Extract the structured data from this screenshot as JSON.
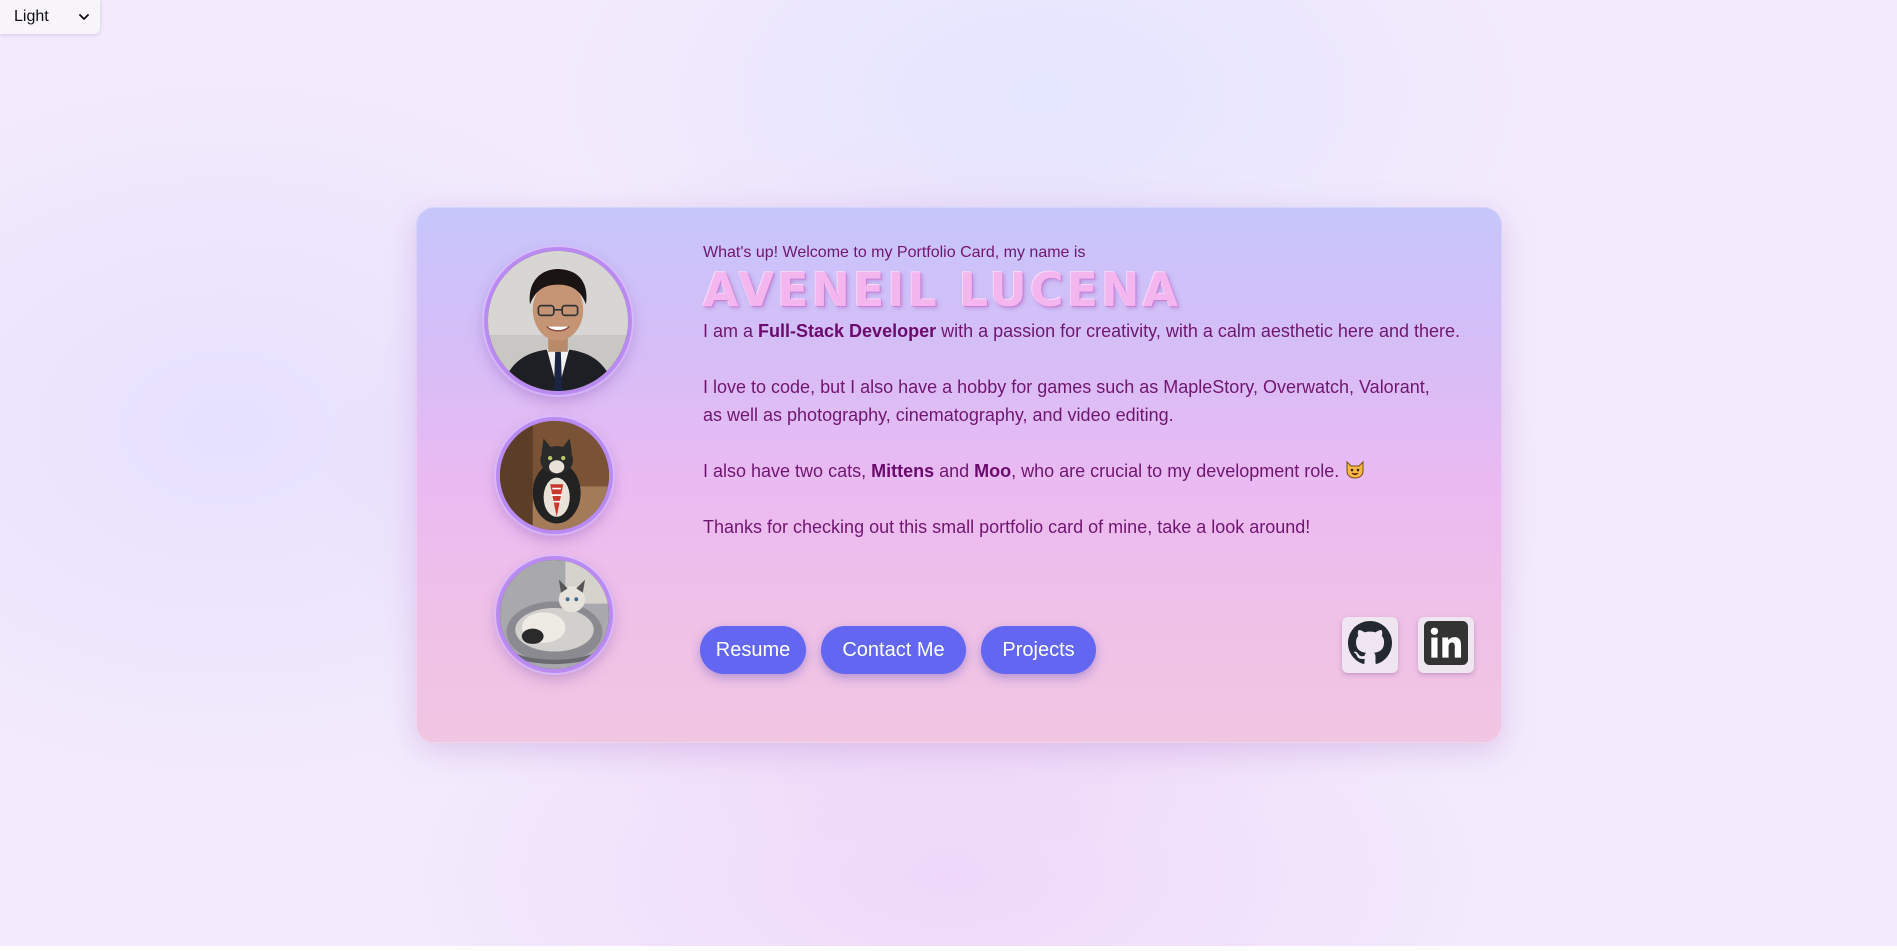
{
  "theme_select": {
    "selected": "Light",
    "icon": "chevron-down-icon"
  },
  "card": {
    "greeting": "What's up! Welcome to my Portfolio Card, my name is",
    "name": "AVENEIL LUCENA",
    "p1": {
      "before": "I am a ",
      "bold": "Full-Stack Developer",
      "after": " with a passion for creativity, with a calm aesthetic here and there."
    },
    "p2": {
      "line1": "I love to code, but I also have a hobby for games such as MapleStory, Overwatch, Valorant,",
      "line2": "as well as photography, cinematography, and video editing."
    },
    "p3": {
      "before": "I also have two cats, ",
      "cat1": "Mittens",
      "and": " and ",
      "cat2": "Moo",
      "after": ", who are crucial to my development role. ",
      "emoji": "cat-face-icon"
    },
    "p4": "Thanks for checking out this small portfolio card of mine, take a look around!"
  },
  "buttons": {
    "resume": "Resume",
    "contact": "Contact Me",
    "projects": "Projects"
  },
  "social": {
    "github_icon": "github-icon",
    "linkedin_icon": "linkedin-icon"
  },
  "colors": {
    "button": "#6366f1",
    "text": "#6f1670",
    "name": "#f3b6ee",
    "avatar_border": "#b98af0"
  }
}
